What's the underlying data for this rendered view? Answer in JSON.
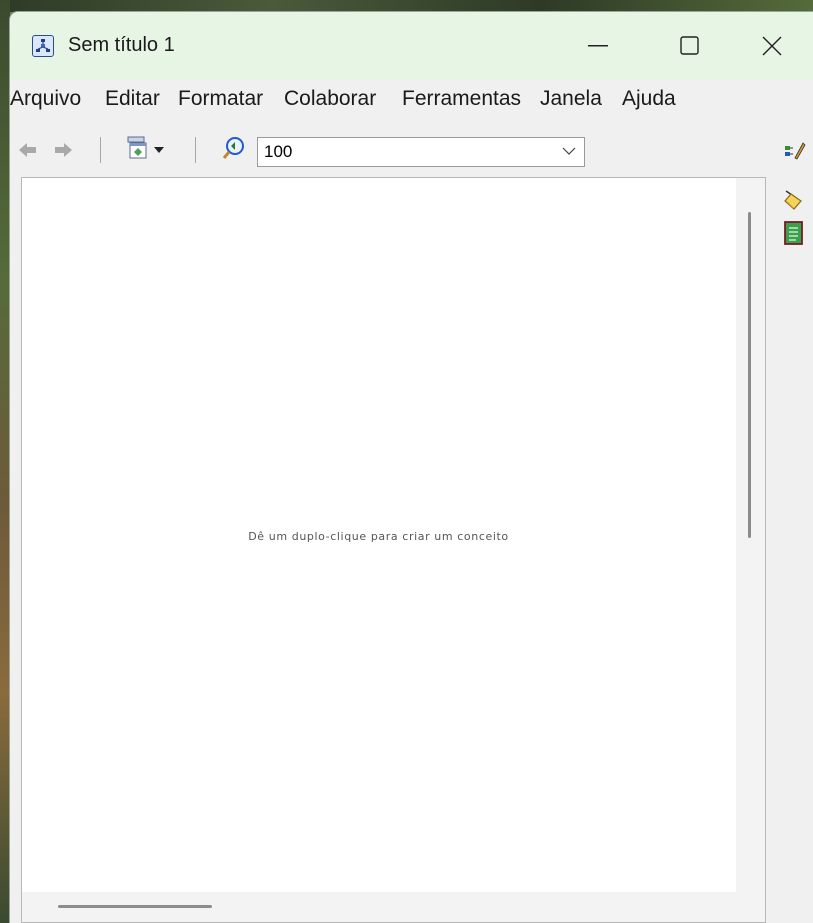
{
  "window": {
    "title": "Sem título 1",
    "controls": {
      "minimize": "minimize",
      "maximize": "maximize",
      "close": "close"
    }
  },
  "menubar": {
    "items": [
      {
        "label": "Arquivo"
      },
      {
        "label": "Editar"
      },
      {
        "label": "Formatar"
      },
      {
        "label": "Colaborar"
      },
      {
        "label": "Ferramentas"
      },
      {
        "label": "Janela"
      },
      {
        "label": "Ajuda"
      }
    ]
  },
  "toolbar": {
    "zoom_value": "100"
  },
  "canvas": {
    "hint": "Dê um duplo-clique para criar um conceito"
  },
  "icons": {
    "app": "concept-map-app-icon",
    "back": "arrow-left-icon",
    "forward": "arrow-right-icon",
    "view": "view-styles-icon",
    "zoom": "zoom-icon",
    "dropdown": "chevron-down-icon",
    "edit_tools": "edit-tools-icon",
    "format_brush": "format-brush-icon",
    "notes": "notes-icon"
  },
  "colors": {
    "titlebar_bg": "#e6f5e4",
    "chrome_bg": "#f0f0f0",
    "canvas_bg": "#ffffff"
  }
}
